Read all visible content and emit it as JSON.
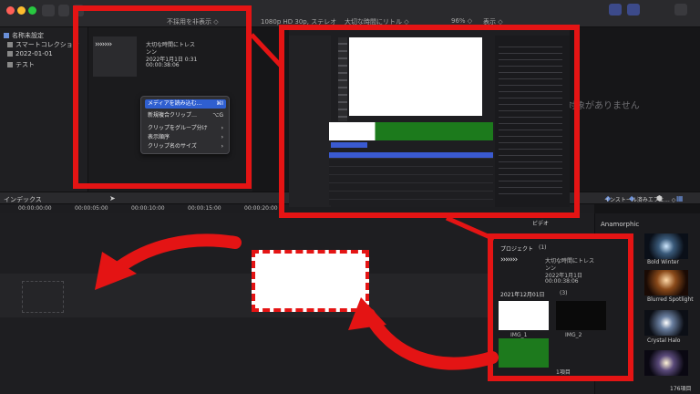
{
  "toolbar": {
    "filter_label": "不採用を非表示 ◇",
    "format_label": "1080p HD 30p, ステレオ",
    "project_label": "大切な時間にリトル ◇",
    "zoom_label": "96% ◇",
    "view_label": "表示 ◇"
  },
  "sidebar": {
    "items": [
      {
        "label": "名称未設定"
      },
      {
        "label": "スマートコレクション"
      },
      {
        "label": "2022-01-01"
      },
      {
        "label": "テスト"
      }
    ]
  },
  "browser": {
    "clip": {
      "arrows": "›››››››",
      "title_line1": "大切な時間にトレス",
      "title_line2": "ンン",
      "date": "2022年1月1日 0:31",
      "duration": "00:00:38:06"
    }
  },
  "context_menu": {
    "items": [
      {
        "label": "メディアを読み込む…",
        "shortcut": "⌘I",
        "selected": true
      },
      {
        "label": "新規複合クリップ…",
        "shortcut": "⌥G",
        "selected": false
      },
      {
        "label": "クリップをグループ分け",
        "shortcut": "›",
        "selected": false
      },
      {
        "label": "表示順序",
        "shortcut": "›",
        "selected": false
      },
      {
        "label": "クリップ名のサイズ",
        "shortcut": "›",
        "selected": false
      }
    ]
  },
  "viewer": {
    "empty_text": "対象がありません"
  },
  "timeline": {
    "index_label": "インデックス",
    "timecodes": [
      "00:00:00:00",
      "00:00:05:00",
      "00:00:10:00",
      "00:00:15:00",
      "00:00:20:00"
    ]
  },
  "effects": {
    "header": "インストール済みエフェ… ◇",
    "category": "ビデオ",
    "items": [
      {
        "label": "Anamorphic"
      },
      {
        "label": "Bold Winter"
      },
      {
        "label": "Blurred Spotlight"
      },
      {
        "label": "Crystal Halo"
      }
    ],
    "count": "176項目"
  },
  "callout_project": {
    "project_header": "プロジェクト",
    "project_count": "(1)",
    "clip_title_line1": "大切な時間にトレス",
    "clip_title_line2": "ンン",
    "clip_date": "2022年1月1日",
    "clip_duration": "00:00:38:06",
    "date_header": "2021年12月01日",
    "date_count": "(3)",
    "thumb1_label": "IMG_1",
    "thumb2_label": "IMG_2",
    "footer": "1項目"
  },
  "colors": {
    "accent_red": "#e41414",
    "selection_blue": "#2f5fd0"
  }
}
